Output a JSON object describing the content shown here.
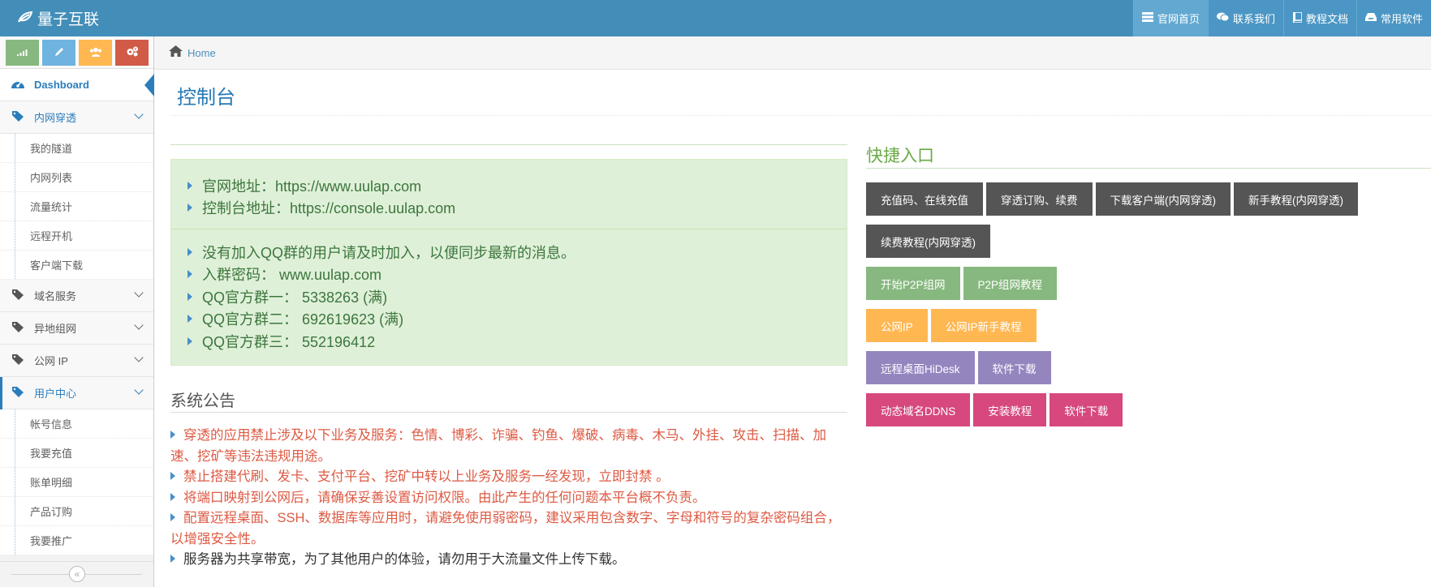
{
  "navbar": {
    "brand": "量子互联",
    "items": [
      {
        "label": "官网首页",
        "icon": "list-icon"
      },
      {
        "label": "联系我们",
        "icon": "chat-icon"
      },
      {
        "label": "教程文档",
        "icon": "book-icon"
      },
      {
        "label": "常用软件",
        "icon": "inbox-icon"
      }
    ]
  },
  "sidebar": {
    "menu": [
      {
        "label": "Dashboard"
      },
      {
        "label": "内网穿透",
        "sub": [
          "我的隧道",
          "内网列表",
          "流量统计",
          "远程开机",
          "客户端下载"
        ]
      },
      {
        "label": "域名服务"
      },
      {
        "label": "异地组网"
      },
      {
        "label": "公网 IP"
      },
      {
        "label": "用户中心",
        "sub": [
          "帐号信息",
          "我要充值",
          "账单明细",
          "产品订购",
          "我要推广"
        ]
      }
    ]
  },
  "breadcrumb": {
    "home": "Home"
  },
  "page": {
    "title": "控制台"
  },
  "info": {
    "group1": [
      "官网地址：https://www.uulap.com",
      "控制台地址：https://console.uulap.com"
    ],
    "group2": [
      "没有加入QQ群的用户请及时加入，以便同步最新的消息。",
      "入群密码： www.uulap.com",
      "QQ官方群一： 5338263 (满)",
      "QQ官方群二： 692619623 (满)",
      "QQ官方群三： 552196412"
    ]
  },
  "notice": {
    "title": "系统公告",
    "items": [
      "穿透的应用禁止涉及以下业务及服务：色情、博彩、诈骗、钓鱼、爆破、病毒、木马、外挂、攻击、扫描、加速、挖矿等违法违规用途。",
      "禁止搭建代刷、发卡、支付平台、挖矿中转以上业务及服务一经发现，立即封禁 。",
      "将端口映射到公网后，请确保妥善设置访问权限。由此产生的任何问题本平台概不负责。",
      "配置远程桌面、SSH、数据库等应用时，请避免使用弱密码，建议采用包含数字、字母和符号的复杂密码组合，以增强安全性。",
      "服务器为共享带宽，为了其他用户的体验，请勿用于大流量文件上传下载。"
    ]
  },
  "quick": {
    "title": "快捷入口",
    "row1": [
      "充值码、在线充值",
      "穿透订购、续费",
      "下载客户端(内网穿透)",
      "新手教程(内网穿透)"
    ],
    "row2": [
      "续费教程(内网穿透)"
    ],
    "row3": [
      "开始P2P组网",
      "P2P组网教程"
    ],
    "row4": [
      "公网IP",
      "公网IP新手教程"
    ],
    "row5": [
      "远程桌面HiDesk",
      "软件下载"
    ],
    "row6": [
      "动态域名DDNS",
      "安装教程",
      "软件下载"
    ]
  },
  "colors": {
    "navbar": "#438eb9",
    "accent": "#2b7dbc",
    "dark_btn": "#555555",
    "green_btn": "#87b87f",
    "orange_btn": "#ffb752",
    "purple_btn": "#9585bf",
    "pink_btn": "#d6487e",
    "notice_red": "#dd5a43",
    "info_green_bg": "#dff0d8"
  }
}
